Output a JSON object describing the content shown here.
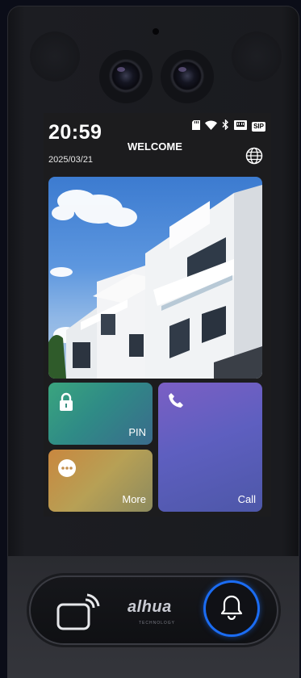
{
  "status": {
    "time": "20:59",
    "date": "2025/03/21",
    "welcome": "WELCOME",
    "sip_label": "SIP"
  },
  "icons": {
    "status_bar": [
      "sd-card-icon",
      "wifi-icon",
      "bluetooth-icon",
      "ethernet-icon",
      "sip-badge"
    ],
    "language": "globe-icon"
  },
  "tiles": {
    "pin": {
      "label": "PIN",
      "icon": "lock-icon"
    },
    "more": {
      "label": "More",
      "icon": "more-icon"
    },
    "call": {
      "label": "Call",
      "icon": "phone-icon"
    }
  },
  "panel": {
    "brand": "alhua",
    "brand_sub": "TECHNOLOGY",
    "card_icon": "nfc-card-icon",
    "bell_icon": "doorbell-icon"
  },
  "colors": {
    "pin_tile": "#3aa57e",
    "more_tile": "#c9873f",
    "call_tile": "#6a5fc4",
    "bell_ring": "#1b6cf2"
  }
}
